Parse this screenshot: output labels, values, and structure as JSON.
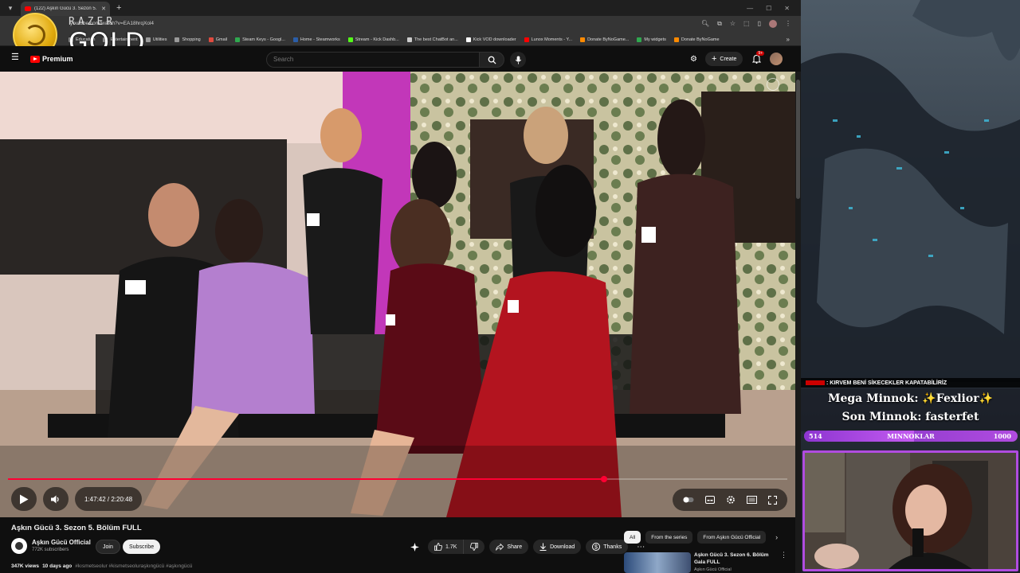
{
  "browser": {
    "tab_title": "(122) Aşkın Gücü 3. Sezon 5. Bö",
    "url": "youtube.com/watch?v=EA18hrqXol4",
    "bookmarks": [
      {
        "label": "Education",
        "color": "#9a9a9a"
      },
      {
        "label": "Entertainment",
        "color": "#9a9a9a"
      },
      {
        "label": "Utilities",
        "color": "#9a9a9a"
      },
      {
        "label": "Shopping",
        "color": "#9a9a9a"
      },
      {
        "label": "Gmail",
        "color": "#e04b3f"
      },
      {
        "label": "Steam Keys - Googl...",
        "color": "#2fa84f"
      },
      {
        "label": "Home - Steamworks",
        "color": "#2b5ea8"
      },
      {
        "label": "Stream - Kick Dashb...",
        "color": "#53fc18"
      },
      {
        "label": "The best ChatBot an...",
        "color": "#cccccc"
      },
      {
        "label": "Kick VOD downloader",
        "color": "#ffffff"
      },
      {
        "label": "Lunox Moments - Y...",
        "color": "#ff0000"
      },
      {
        "label": "Donate ByNoGame...",
        "color": "#ff8a00"
      },
      {
        "label": "My widgets",
        "color": "#2fa84f"
      },
      {
        "label": "Donate ByNoGame",
        "color": "#ff8a00"
      }
    ]
  },
  "overlay_brand": {
    "razer": "RAZER",
    "gold": "GOLD"
  },
  "youtube": {
    "logo_label": "Premium",
    "search_placeholder": "Search",
    "create_label": "Create",
    "notif_badge": "9+",
    "player": {
      "current_time": "1:47:42",
      "duration": "2:20:48",
      "time_display": "1:47:42 / 2:20:48",
      "progress_fraction": 0.765
    },
    "video": {
      "title": "Aşkın Gücü 3. Sezon 5. Bölüm FULL",
      "channel": "Aşkın Gücü Official",
      "subscribers": "772K subscribers",
      "join_label": "Join",
      "subscribe_label": "Subscribe",
      "likes": "1.7K",
      "share_label": "Share",
      "download_label": "Download",
      "thanks_label": "Thanks",
      "views": "347K views",
      "age": "10 days ago",
      "hashtags": "#kısmetseolur #kismetseoluraşkıngücü #aşkıngücü"
    },
    "chips": [
      "All",
      "From the series",
      "From Aşkın Gücü Official"
    ],
    "recommendation": {
      "title": "Aşkın Gücü 3. Sezon 6. Bölüm Gala FULL",
      "channel": "Aşkın Gücü Official"
    }
  },
  "stream_overlay": {
    "ticker": ": KIRVEM BENİ SİKECEKLER KAPATABİLİRİZ",
    "mega_minnok": "Mega Minnok: ✨Fexlior✨",
    "son_minnok": "Son Minnok: fasterfet",
    "bar": {
      "min": "514",
      "label": "MINNOKLAR",
      "max": "1000",
      "fill_fraction": 0.514
    }
  }
}
